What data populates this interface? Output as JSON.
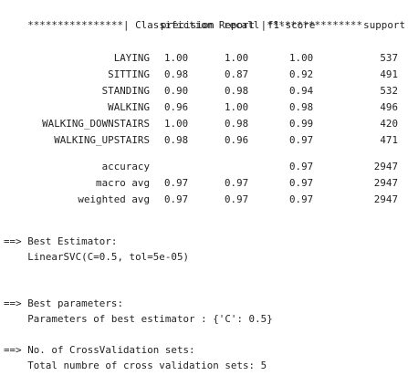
{
  "report": {
    "header_left": "****************|",
    "title": " Classifiction Report ",
    "header_right": "|****************",
    "columns": [
      "precision",
      "recall",
      "f1-score",
      "support"
    ],
    "rows": [
      {
        "label": "LAYING",
        "precision": "1.00",
        "recall": "1.00",
        "f1": "1.00",
        "support": "537"
      },
      {
        "label": "SITTING",
        "precision": "0.98",
        "recall": "0.87",
        "f1": "0.92",
        "support": "491"
      },
      {
        "label": "STANDING",
        "precision": "0.90",
        "recall": "0.98",
        "f1": "0.94",
        "support": "532"
      },
      {
        "label": "WALKING",
        "precision": "0.96",
        "recall": "1.00",
        "f1": "0.98",
        "support": "496"
      },
      {
        "label": "WALKING_DOWNSTAIRS",
        "precision": "1.00",
        "recall": "0.98",
        "f1": "0.99",
        "support": "420"
      },
      {
        "label": "WALKING_UPSTAIRS",
        "precision": "0.98",
        "recall": "0.96",
        "f1": "0.97",
        "support": "471"
      }
    ],
    "summary": [
      {
        "label": "accuracy",
        "precision": "",
        "recall": "",
        "f1": "0.97",
        "support": "2947"
      },
      {
        "label": "macro avg",
        "precision": "0.97",
        "recall": "0.97",
        "f1": "0.97",
        "support": "2947"
      },
      {
        "label": "weighted avg",
        "precision": "0.97",
        "recall": "0.97",
        "f1": "0.97",
        "support": "2947"
      }
    ]
  },
  "best_estimator": {
    "heading": "==> Best Estimator:",
    "value": "    LinearSVC(C=0.5, tol=5e-05)"
  },
  "best_parameters": {
    "heading": "==> Best parameters:",
    "value": "    Parameters of best estimator : {'C': 0.5}"
  },
  "cross_validation": {
    "heading": "==> No. of CrossValidation sets:",
    "value": "    Total numbre of cross validation sets: 5"
  }
}
